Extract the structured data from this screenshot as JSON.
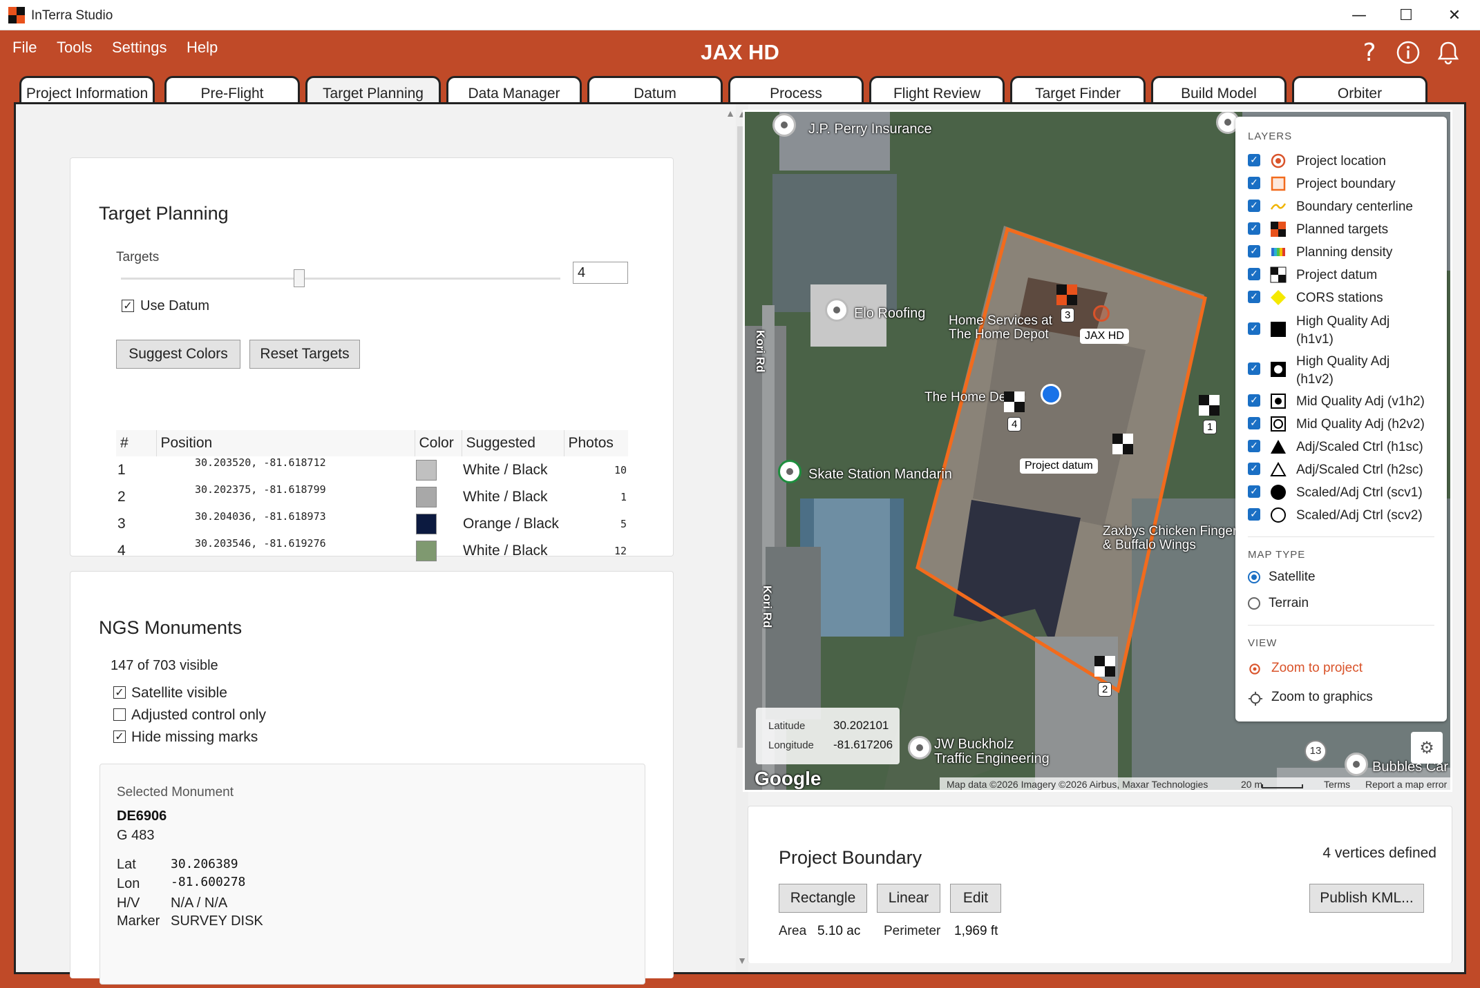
{
  "app": {
    "title": "InTerra Studio",
    "project": "JAX HD",
    "win_min": "—",
    "win_max": "☐",
    "win_close": "✕"
  },
  "menu": [
    "File",
    "Tools",
    "Settings",
    "Help"
  ],
  "header_icons": {
    "help": "?",
    "info": "ⓘ",
    "bell": "🔔",
    "help_icon": "help-icon",
    "info_icon": "info-icon",
    "bell_icon": "bell-icon"
  },
  "tabs": [
    "Project Information",
    "Pre-Flight",
    "Target Planning",
    "Data Manager",
    "Datum",
    "Process",
    "Flight Review",
    "Target Finder",
    "Build Model",
    "Orbiter"
  ],
  "active_tab": "Target Planning",
  "target_planning": {
    "title": "Target Planning",
    "targets_label": "Targets",
    "targets_value": "4",
    "slider_fraction": 0.405,
    "use_datum": "Use Datum",
    "suggest_colors": "Suggest Colors",
    "reset_targets": "Reset Targets",
    "columns": [
      "#",
      "Position",
      "Color",
      "Suggested",
      "Photos"
    ],
    "rows": [
      {
        "n": "1",
        "pos": "30.203520, -81.618712",
        "color": "#c0c0c0",
        "suggested": "White / Black",
        "photos": "10"
      },
      {
        "n": "2",
        "pos": "30.202375, -81.618799",
        "color": "#a8a8a8",
        "suggested": "White / Black",
        "photos": "1"
      },
      {
        "n": "3",
        "pos": "30.204036, -81.618973",
        "color": "#0c1a40",
        "suggested": "Orange / Black",
        "photos": "5"
      },
      {
        "n": "4",
        "pos": "30.203546, -81.619276",
        "color": "#7f9970",
        "suggested": "White / Black",
        "photos": "12"
      }
    ]
  },
  "ngs": {
    "title": "NGS Monuments",
    "visible": "147 of 703 visible",
    "satellite_visible": "Satellite visible",
    "adjusted_only": "Adjusted control only",
    "hide_missing": "Hide missing marks",
    "selected_title": "Selected Monument",
    "id": "DE6906",
    "name": "G 483",
    "lat_label": "Lat",
    "lat": "30.206389",
    "lon_label": "Lon",
    "lon": "-81.600278",
    "hv_label": "H/V",
    "hv": "N/A / N/A",
    "marker_label": "Marker",
    "marker": "SURVEY DISK"
  },
  "map": {
    "labels": {
      "jp_perry": "J.P. Perry Insurance",
      "elo": "Elo Roofing",
      "home_services": "Home Services at\nThe Home Depot",
      "home_depot": "The Home Depot",
      "skate": "Skate Station Mandarin",
      "zaxbys": "Zaxbys Chicken Fingers\n& Buffalo Wings",
      "kori1": "Kori Rd",
      "kori2": "Kori Rd",
      "jw": "JW Buckholz\nTraffic Engineering",
      "bubbles": "Bubbles Car",
      "route": "13",
      "google": "Google"
    },
    "tags": {
      "jax": "JAX HD",
      "datum": "Project datum",
      "t1": "1",
      "t2": "2",
      "t3": "3",
      "t4": "4"
    },
    "lat_label": "Latitude",
    "lat": "30.202101",
    "lon_label": "Longitude",
    "lon": "-81.617206",
    "attribution": "Map data ©2026 Imagery ©2026 Airbus, Maxar Technologies",
    "scale": "20 m",
    "terms": "Terms",
    "report": "Report a map error",
    "boundary_color": "#f26b1d",
    "settings_icon": "gear-icon"
  },
  "layers": {
    "title": "LAYERS",
    "items": [
      "Project location",
      "Project boundary",
      "Boundary centerline",
      "Planned targets",
      "Planning density",
      "Project datum",
      "CORS stations",
      "High Quality Adj\n(h1v1)",
      "High Quality Adj\n(h1v2)",
      "Mid Quality Adj (v1h2)",
      "Mid Quality Adj (h2v2)",
      "Adj/Scaled Ctrl (h1sc)",
      "Adj/Scaled Ctrl (h2sc)",
      "Scaled/Adj Ctrl (scv1)",
      "Scaled/Adj Ctrl (scv2)"
    ],
    "map_type_title": "MAP TYPE",
    "satellite": "Satellite",
    "terrain": "Terrain",
    "view_title": "VIEW",
    "zoom_project": "Zoom to project",
    "zoom_graphics": "Zoom to graphics"
  },
  "boundary": {
    "title": "Project Boundary",
    "vertices": "4 vertices defined",
    "rectangle": "Rectangle",
    "linear": "Linear",
    "edit": "Edit",
    "publish": "Publish KML...",
    "area_label": "Area",
    "area": "5.10 ac",
    "perimeter_label": "Perimeter",
    "perimeter": "1,969 ft"
  }
}
